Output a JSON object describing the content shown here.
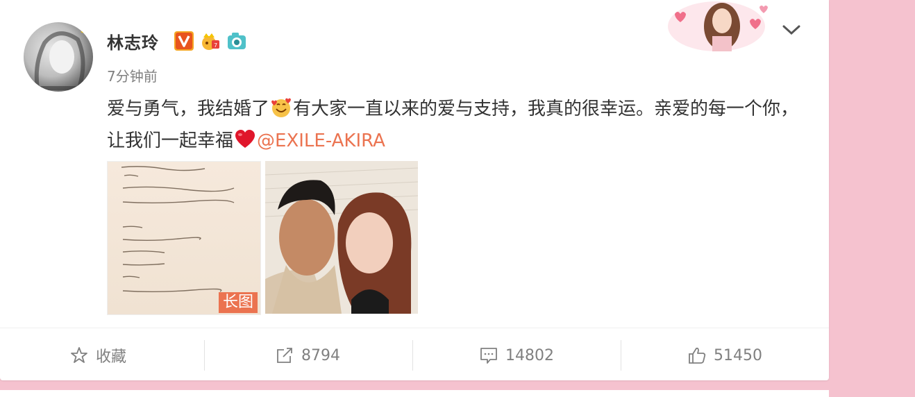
{
  "post": {
    "username": "林志玲",
    "time": "7分钟前",
    "text_part1": "爱与勇气，我结婚了",
    "text_part2": "有大家一直以来的爱与支持，我真的很幸运。亲爱的每一个你，让我们一起幸福",
    "mention": "@EXILE-AKIRA",
    "long_image_tag": "长图",
    "letter_lines": [
      "我想…",
      "需要勇气·包容·无私·坚持·天真…",
      "才能将一瞬间化成一生的陪伴。",
      "",
      "我愿意，",
      "一起去面对每一个未知，",
      "与每一次起伏…",
      "一同跌宕·喜悦。",
      "勇敢吧！",
      "让未来到来，让过去过去。"
    ]
  },
  "actions": {
    "favorite_label": "收藏",
    "repost_count": "8794",
    "comment_count": "14802",
    "like_count": "51450"
  },
  "colors": {
    "background": "#f5c2cf",
    "mention": "#eb7350",
    "text": "#333333",
    "muted": "#808080"
  },
  "icons": [
    "verified-v-icon",
    "member-crown-icon",
    "camera-icon",
    "chevron-down-icon",
    "star-icon",
    "repost-icon",
    "comment-icon",
    "thumbs-up-icon"
  ]
}
